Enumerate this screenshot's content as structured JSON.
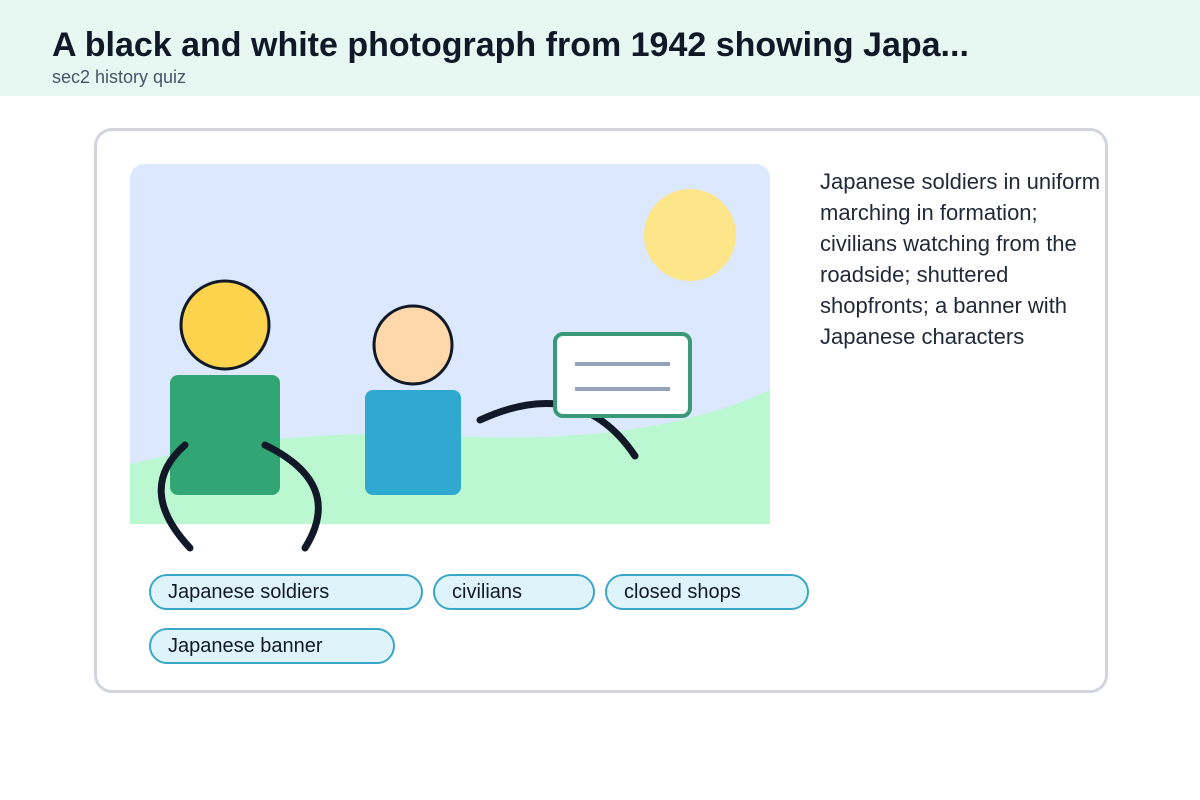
{
  "header": {
    "title": "A black and white photograph from 1942 showing Japa...",
    "subtitle": "sec2 history quiz"
  },
  "card": {
    "description": "Japanese soldiers in uniform marching in formation; civilians watching from the roadside; shuttered shopfronts; a banner with Japanese characters",
    "tags": [
      "Japanese soldiers",
      "civilians",
      "closed shops",
      "Japanese banner"
    ]
  },
  "colors": {
    "header_bg": "#e6f8f1",
    "sky": "#dbe8fd",
    "ground": "#bbf7d0",
    "sun": "#fde68a",
    "figure1_head": "#fcd34d",
    "figure1_body": "#31a574",
    "figure2_head": "#fed7aa",
    "figure2_body": "#30a9d1",
    "banner_border": "#3a9a78",
    "tag_bg": "#dff4fa",
    "tag_border": "#3aa6c8"
  }
}
